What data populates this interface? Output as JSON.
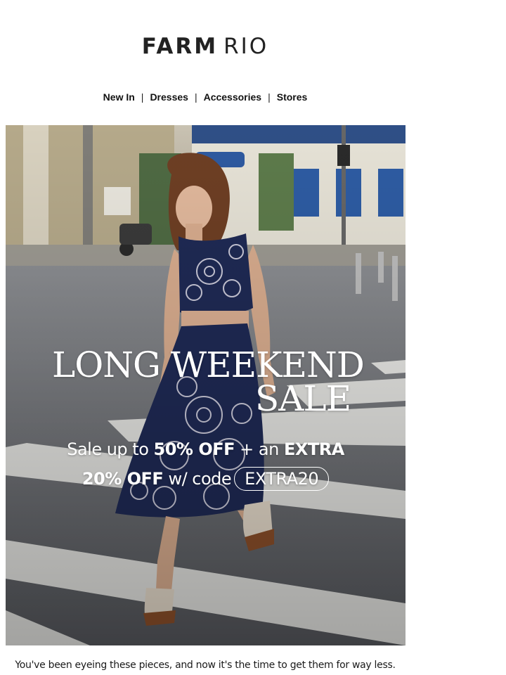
{
  "brand": {
    "name_bold": "FARM",
    "name_light": "RIO"
  },
  "nav": {
    "items": [
      {
        "label": "New In"
      },
      {
        "label": "Dresses"
      },
      {
        "label": "Accessories"
      },
      {
        "label": "Stores"
      }
    ],
    "separator": "|"
  },
  "hero": {
    "headline_line1": "LONG WEEKEND",
    "headline_line2": "SALE",
    "offer_line1_a": "Sale up to ",
    "offer_line1_b": "50% OFF",
    "offer_line1_c": " + an ",
    "offer_line1_d": "EXTRA",
    "offer_line2_a": "20% OFF",
    "offer_line2_b": " w/ code",
    "promo_code": "EXTRA20"
  },
  "body": {
    "tagline": "You've been eyeing these pieces, and now it's the time to get them for way less."
  },
  "colors": {
    "text": "#1a1a1a",
    "hero_text": "#ffffff",
    "outfit_navy": "#1f2a55"
  }
}
